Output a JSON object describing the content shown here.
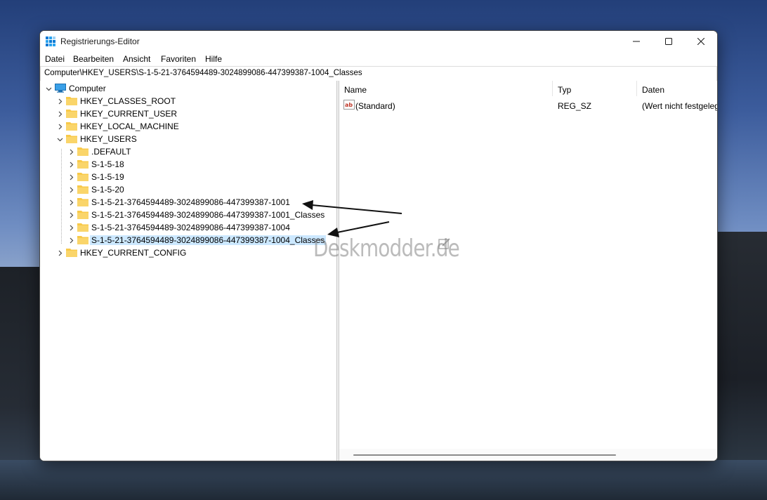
{
  "window": {
    "title": "Registrierungs-Editor",
    "accent_color": "#0078d4"
  },
  "menu": {
    "items": [
      "Datei",
      "Bearbeiten",
      "Ansicht",
      "Favoriten",
      "Hilfe"
    ]
  },
  "address": {
    "path": "Computer\\HKEY_USERS\\S-1-5-21-3764594489-3024899086-447399387-1004_Classes"
  },
  "tree": {
    "root": "Computer",
    "hives": {
      "classes_root": "HKEY_CLASSES_ROOT",
      "current_user": "HKEY_CURRENT_USER",
      "local_machine": "HKEY_LOCAL_MACHINE",
      "users": "HKEY_USERS",
      "current_config": "HKEY_CURRENT_CONFIG"
    },
    "user_children": [
      ".DEFAULT",
      "S-1-5-18",
      "S-1-5-19",
      "S-1-5-20",
      "S-1-5-21-3764594489-3024899086-447399387-1001",
      "S-1-5-21-3764594489-3024899086-447399387-1001_Classes",
      "S-1-5-21-3764594489-3024899086-447399387-1004",
      "S-1-5-21-3764594489-3024899086-447399387-1004_Classes"
    ],
    "selected": "S-1-5-21-3764594489-3024899086-447399387-1004_Classes",
    "selection_color": "#cce8ff",
    "folder_color": "#f8c948"
  },
  "values": {
    "columns": [
      "Name",
      "Typ",
      "Daten"
    ],
    "rows": [
      {
        "name": "(Standard)",
        "type": "REG_SZ",
        "data": "(Wert nicht festgeleg"
      }
    ]
  },
  "watermark": {
    "text": "Deskmodder.de"
  }
}
